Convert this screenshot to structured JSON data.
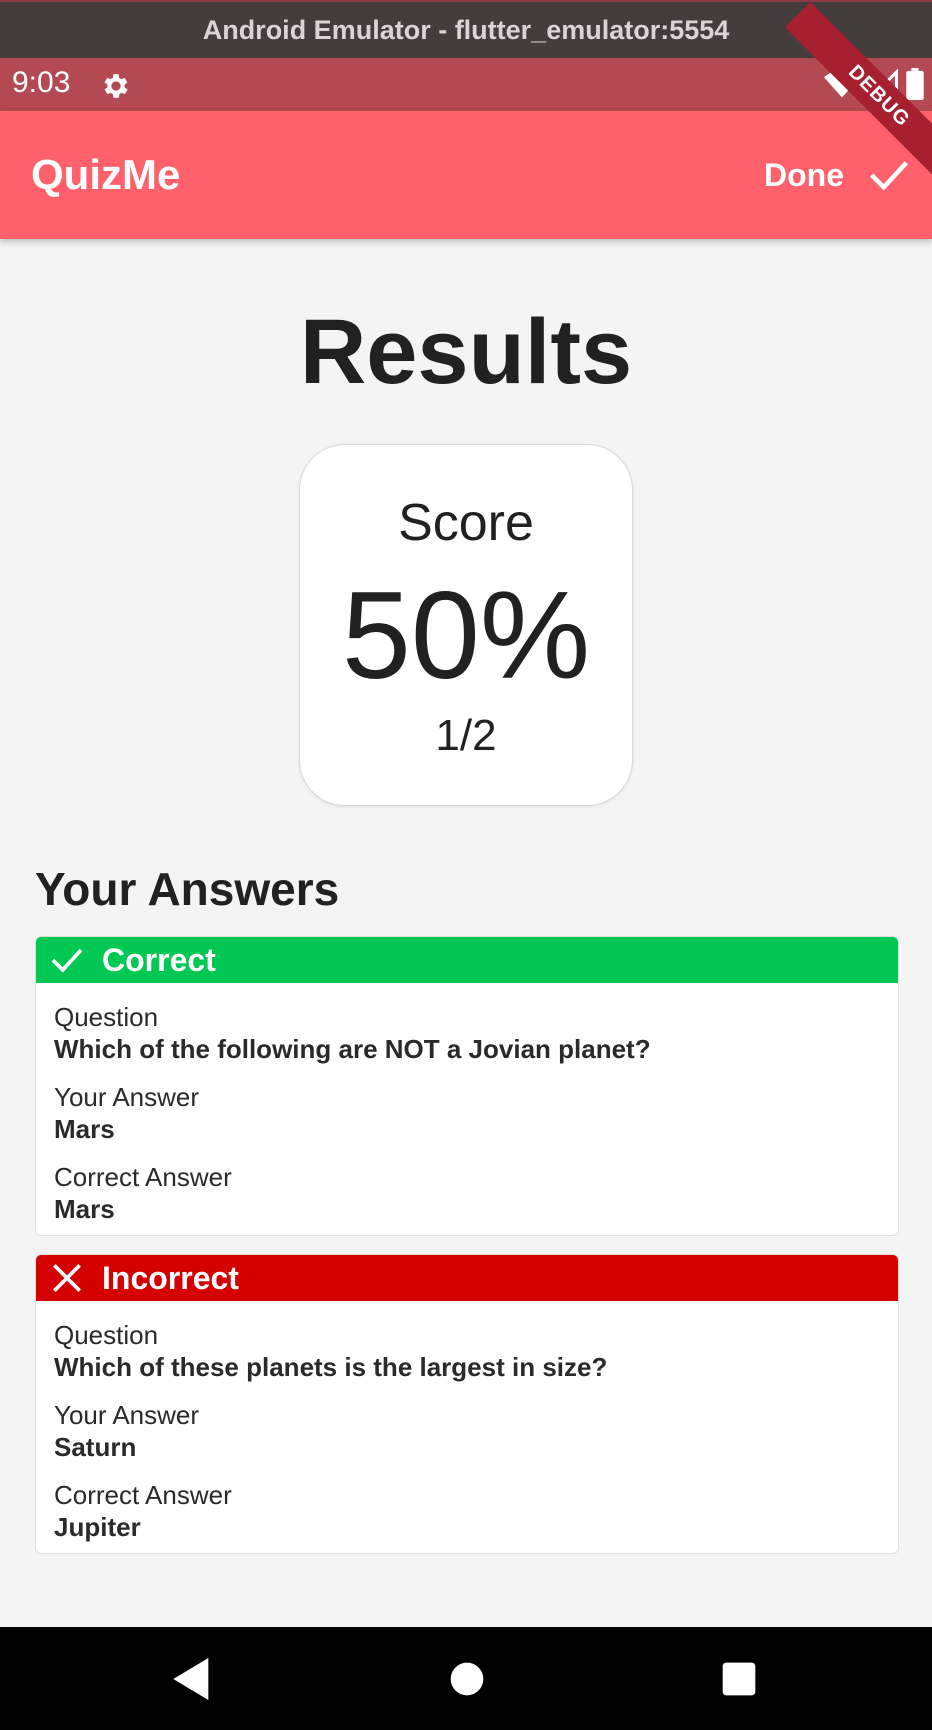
{
  "window": {
    "title": "Android Emulator - flutter_emulator:5554"
  },
  "status_bar": {
    "time": "9:03",
    "icons": [
      "gear-icon",
      "wifi-icon",
      "signal-icon",
      "battery-icon"
    ]
  },
  "debug_banner": "DEBUG",
  "app_bar": {
    "title": "QuizMe",
    "done_label": "Done",
    "done_icon": "check-icon",
    "color": "#fe616b"
  },
  "results": {
    "heading": "Results",
    "score_label": "Score",
    "score_percent": "50%",
    "score_fraction": "1/2"
  },
  "answers": {
    "heading": "Your Answers",
    "items": [
      {
        "status": "Correct",
        "status_icon": "check-icon",
        "status_color": "#00c853",
        "question_label": "Question",
        "question": "Which of the following are NOT a Jovian planet?",
        "your_answer_label": "Your Answer",
        "your_answer": "Mars",
        "correct_answer_label": "Correct Answer",
        "correct_answer": "Mars"
      },
      {
        "status": "Incorrect",
        "status_icon": "close-icon",
        "status_color": "#d50000",
        "question_label": "Question",
        "question": "Which of these planets is the largest in size?",
        "your_answer_label": "Your Answer",
        "your_answer": "Saturn",
        "correct_answer_label": "Correct Answer",
        "correct_answer": "Jupiter"
      }
    ]
  },
  "nav_bar": {
    "buttons": [
      "back-icon",
      "home-icon",
      "recents-icon"
    ]
  }
}
